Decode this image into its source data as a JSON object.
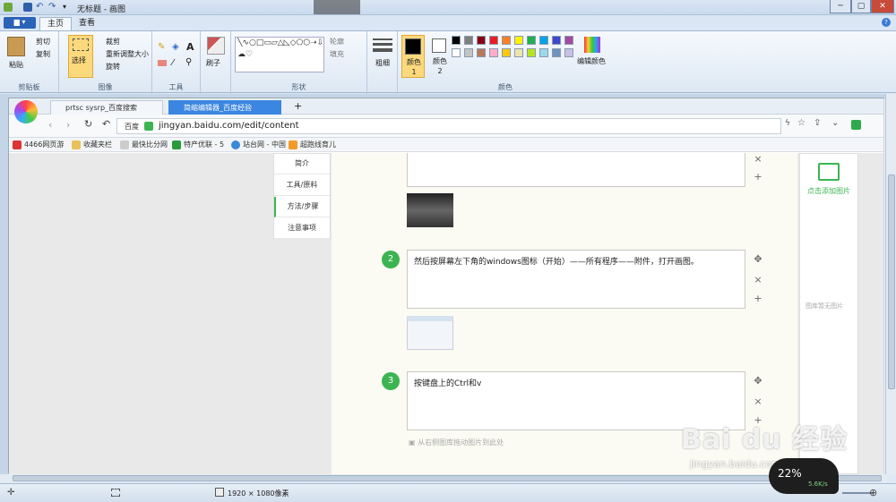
{
  "window": {
    "title": "无标题 - 画图",
    "min": "─",
    "max": "▢",
    "close": "✕"
  },
  "ribbon": {
    "file_label": "▆ ▾",
    "tabs": [
      "主页",
      "查看"
    ],
    "clipboard": {
      "paste": "粘贴",
      "cut": "剪切",
      "copy": "复制",
      "group": "剪贴板"
    },
    "image": {
      "select": "选择",
      "crop": "裁剪",
      "resize": "重新调整大小",
      "rotate": "旋转",
      "group": "图像"
    },
    "tools": {
      "group": "工具"
    },
    "brush": {
      "label": "刷子"
    },
    "shapes": {
      "outline": "轮廓",
      "fill": "填充",
      "group": "形状"
    },
    "size": {
      "label": "粗细"
    },
    "colors": {
      "color1": "颜色 1",
      "color2": "颜色 2",
      "edit": "编辑颜色",
      "group": "颜色"
    }
  },
  "palette": [
    "#000000",
    "#7f7f7f",
    "#880015",
    "#ed1c24",
    "#ff7f27",
    "#fff200",
    "#22b14c",
    "#00a2e8",
    "#3f48cc",
    "#a349a4",
    "#ffffff",
    "#c3c3c3",
    "#b97a57",
    "#ffaec9",
    "#ffc90e",
    "#efe4b0",
    "#b5e61d",
    "#99d9ea",
    "#7092be",
    "#c8bfe7"
  ],
  "browser": {
    "tabs": [
      {
        "title": "prtsc sysrp_百度搜索"
      },
      {
        "title": "简缩编辑器_百度经验"
      }
    ],
    "new_tab": "+",
    "url_prefix": "百度",
    "url": "jingyan.baidu.com/edit/content",
    "bookmarks": [
      "4466网页游",
      "收藏夹栏",
      "最快比分网",
      "特产优联 - 5",
      "站台网 - 中国",
      "超跑线育儿"
    ]
  },
  "page": {
    "nav": [
      "简介",
      "工具/原料",
      "方法/步骤",
      "注意事项"
    ],
    "steps": [
      {
        "num": "2",
        "text": "然后按屏幕左下角的windows图标（开始）——所有程序——附件，打开画图。"
      },
      {
        "num": "3",
        "text": "按键盘上的Ctrl和v"
      }
    ],
    "drag_hint": "从右侧图库拖动图片到此处",
    "add_image": "点击添加图片",
    "no_image": "图库暂无图片"
  },
  "status": {
    "dimensions": "1920 × 1080像素"
  },
  "watermark": {
    "brand": "Bai du 经验",
    "site": "jingyan.baidu.com"
  },
  "net": {
    "percent": "22%",
    "speed": "5.6K/s"
  }
}
